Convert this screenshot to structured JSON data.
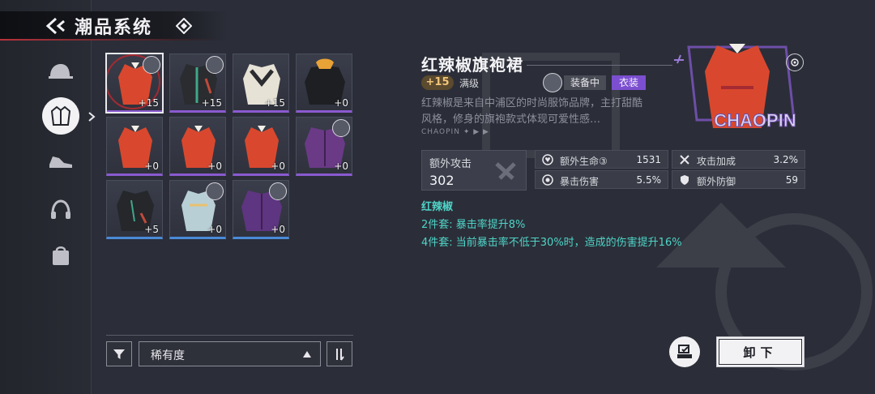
{
  "header": {
    "title": "潮品系统"
  },
  "nav": {
    "items": [
      {
        "name": "hat-icon",
        "active": false
      },
      {
        "name": "coat-icon",
        "active": true
      },
      {
        "name": "shoe-icon",
        "active": false
      },
      {
        "name": "headphone-icon",
        "active": false
      },
      {
        "name": "bag-icon",
        "active": false
      }
    ]
  },
  "grid": {
    "items": [
      {
        "level": "+15",
        "color": "red",
        "owner": true,
        "selected": true,
        "rarity": "purple"
      },
      {
        "level": "+15",
        "color": "dark",
        "owner": true,
        "selected": false,
        "rarity": "purple"
      },
      {
        "level": "+15",
        "color": "white",
        "owner": false,
        "selected": false,
        "rarity": "purple"
      },
      {
        "level": "+0",
        "color": "black",
        "owner": false,
        "selected": false,
        "rarity": "purple"
      },
      {
        "level": "+0",
        "color": "red",
        "owner": false,
        "selected": false,
        "rarity": "purple"
      },
      {
        "level": "+0",
        "color": "red",
        "owner": false,
        "selected": false,
        "rarity": "purple"
      },
      {
        "level": "+0",
        "color": "red",
        "owner": false,
        "selected": false,
        "rarity": "purple"
      },
      {
        "level": "+0",
        "color": "purple",
        "owner": true,
        "selected": false,
        "rarity": "purple"
      },
      {
        "level": "+5",
        "color": "dark",
        "owner": false,
        "selected": false,
        "rarity": "blue"
      },
      {
        "level": "+0",
        "color": "light",
        "owner": true,
        "selected": false,
        "rarity": "blue"
      },
      {
        "level": "+0",
        "color": "purple",
        "owner": true,
        "selected": false,
        "rarity": "blue"
      }
    ]
  },
  "sort": {
    "label": "稀有度"
  },
  "detail": {
    "name": "红辣椒旗袍裙",
    "level": "+15",
    "max_level": "满级",
    "equipped": "装备中",
    "type": "衣装",
    "description": "红辣椒是来自中浦区的时尚服饰品牌，主打甜酷风格，修身的旗袍款式体现可爱性感…",
    "brand_strip": "CHAOPIN",
    "art_text": "CHAOPIN",
    "main_stat": {
      "label": "额外攻击",
      "value": "302"
    },
    "sub_stats": [
      {
        "label": "额外生命③",
        "value": "1531",
        "icon": "heart-icon"
      },
      {
        "label": "攻击加成",
        "value": "3.2%",
        "icon": "swords-icon"
      },
      {
        "label": "暴击伤害",
        "value": "5.5%",
        "icon": "crit-icon"
      },
      {
        "label": "额外防御",
        "value": "59",
        "icon": "shield-icon"
      }
    ],
    "set": {
      "name": "红辣椒",
      "bonus2": "2件套: 暴击率提升8%",
      "bonus4": "4件套: 当前暴击率不低于30%时，造成的伤害提升16%"
    }
  },
  "actions": {
    "unequip": "卸下"
  },
  "colors": {
    "accent_teal": "#4fd4c8",
    "rarity_purple": "#8a5ad0",
    "rarity_blue": "#4a8ad8",
    "level_gold": "#f0c47a"
  }
}
